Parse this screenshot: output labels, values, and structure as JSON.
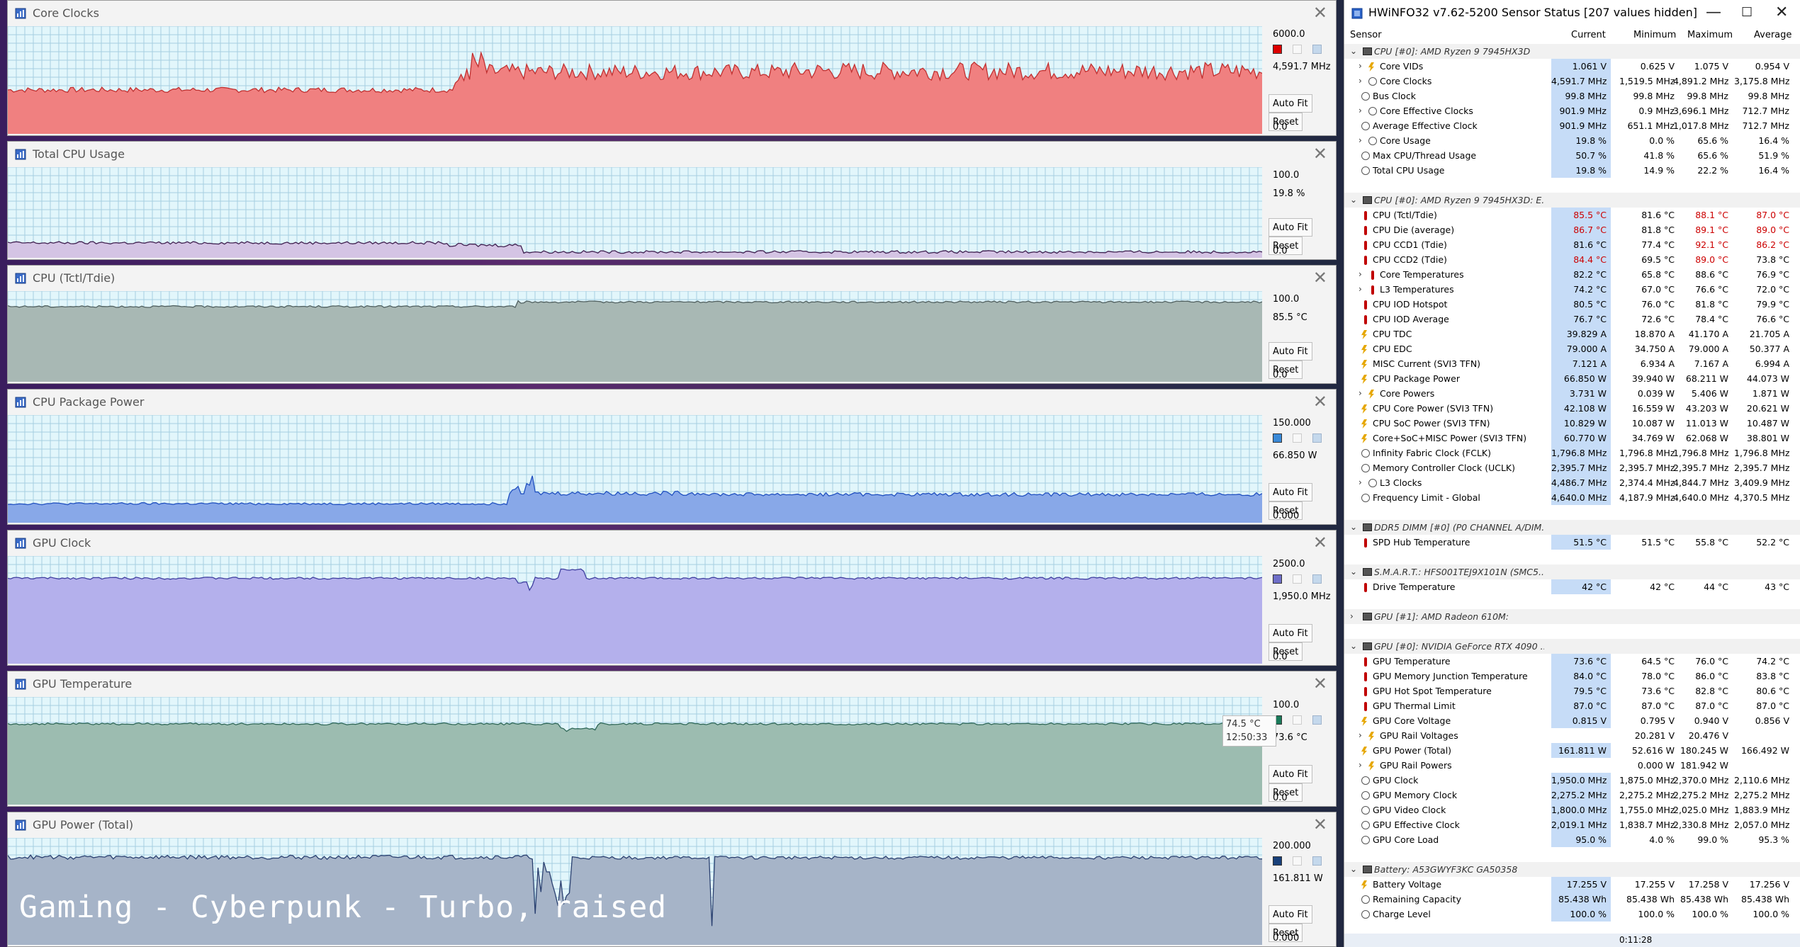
{
  "caption": "Gaming - Cyberpunk - Turbo, raised",
  "graph_buttons": {
    "autofit": "Auto Fit",
    "reset": "Reset"
  },
  "tooltip": {
    "value": "74.5 °C",
    "time": "12:50:33"
  },
  "graphs": [
    {
      "id": "core-clocks",
      "title": "Core Clocks",
      "max": "6000.0",
      "current": "4,591.7 MHz",
      "min": "0.0",
      "color": "#f08080",
      "line": "#c03030",
      "square": "#dd0000",
      "ymax": 6000,
      "segments": [
        [
          0,
          0.355,
          2300,
          2600
        ],
        [
          0.355,
          0.365,
          2500,
          3400
        ],
        [
          0.365,
          0.38,
          2800,
          4700
        ],
        [
          0.38,
          0.62,
          3000,
          3900
        ],
        [
          0.62,
          1.0,
          3000,
          4000
        ]
      ]
    },
    {
      "id": "total-cpu-usage",
      "title": "Total CPU Usage",
      "max": "100.0",
      "current": "19.8 %",
      "min": "0.0",
      "color": "#d4c4e4",
      "line": "#402050",
      "square": "",
      "ymax": 100,
      "segments": [
        [
          0,
          0.35,
          15,
          18
        ],
        [
          0.35,
          0.41,
          12,
          16
        ],
        [
          0.41,
          1.0,
          5,
          8
        ]
      ]
    },
    {
      "id": "cpu-tctl",
      "title": "CPU (Tctl/Tdie)",
      "max": "100.0",
      "current": "85.5 °C",
      "min": "0.0",
      "color": "#a8b8b4",
      "line": "#506060",
      "square": "",
      "ymax": 100,
      "segments": [
        [
          0,
          0.405,
          82,
          84
        ],
        [
          0.405,
          0.41,
          86,
          90
        ],
        [
          0.41,
          1.0,
          87,
          89
        ]
      ]
    },
    {
      "id": "cpu-package-power",
      "title": "CPU Package Power",
      "max": "150.000",
      "current": "66.850 W",
      "min": "0.000",
      "color": "#88a8e8",
      "line": "#2050c0",
      "square": "#3a8ad8",
      "ymax": 150,
      "segments": [
        [
          0,
          0.4,
          25,
          28
        ],
        [
          0.4,
          0.42,
          40,
          70
        ],
        [
          0.42,
          0.56,
          38,
          44
        ],
        [
          0.56,
          1.0,
          37,
          42
        ]
      ]
    },
    {
      "id": "gpu-clock",
      "title": "GPU Clock",
      "max": "2500.0",
      "current": "1,950.0 MHz",
      "min": "0.0",
      "color": "#b4b0ec",
      "line": "#4040a0",
      "square": "#6f6fc8",
      "ymax": 2500,
      "segments": [
        [
          0,
          0.405,
          1960,
          2010
        ],
        [
          0.405,
          0.42,
          1700,
          1900
        ],
        [
          0.44,
          0.46,
          2150,
          2200
        ],
        [
          0.46,
          1.0,
          1960,
          2010
        ]
      ]
    },
    {
      "id": "gpu-temperature",
      "title": "GPU Temperature",
      "max": "100.0",
      "current": "73.6 °C",
      "min": "0.0",
      "color": "#9cbcb0",
      "line": "#306858",
      "square": "#1a7a5a",
      "ymax": 100,
      "segments": [
        [
          0,
          0.44,
          74,
          76
        ],
        [
          0.44,
          0.47,
          68,
          72
        ],
        [
          0.47,
          1.0,
          74,
          76
        ]
      ]
    },
    {
      "id": "gpu-power-total",
      "title": "GPU Power (Total)",
      "max": "200.000",
      "current": "161.811 W",
      "min": "0.000",
      "color": "#a6b4c8",
      "line": "#2a4070",
      "square": "#18407a",
      "ymax": 200,
      "segments": [
        [
          0,
          0.42,
          160,
          168
        ],
        [
          0.42,
          0.45,
          30,
          160
        ],
        [
          0.45,
          0.56,
          160,
          166
        ],
        [
          0.56,
          0.562,
          20,
          160
        ],
        [
          0.562,
          1.0,
          160,
          166
        ]
      ]
    }
  ],
  "hw": {
    "title": "HWiNFO32 v7.62-5200 Sensor Status [207 values hidden]",
    "columns": {
      "sensor": "Sensor",
      "current": "Current",
      "minimum": "Minimum",
      "maximum": "Maximum",
      "average": "Average"
    },
    "status_time": "0:11:28",
    "rows": [
      {
        "g": 1,
        "icon": "chip",
        "name": "CPU [#0]: AMD Ryzen 9 7945HX3D"
      },
      {
        "icon": "bolt",
        "exp": 1,
        "name": "Core VIDs",
        "c": "1.061 V",
        "mi": "0.625 V",
        "ma": "1.075 V",
        "a": "0.954 V"
      },
      {
        "icon": "clock",
        "exp": 1,
        "name": "Core Clocks",
        "c": "4,591.7 MHz",
        "mi": "1,519.5 MHz",
        "ma": "4,891.2 MHz",
        "a": "3,175.8 MHz"
      },
      {
        "icon": "clock",
        "name": "Bus Clock",
        "c": "99.8 MHz",
        "mi": "99.8 MHz",
        "ma": "99.8 MHz",
        "a": "99.8 MHz"
      },
      {
        "icon": "clock",
        "exp": 1,
        "name": "Core Effective Clocks",
        "c": "901.9 MHz",
        "mi": "0.9 MHz",
        "ma": "3,696.1 MHz",
        "a": "712.7 MHz"
      },
      {
        "icon": "clock",
        "name": "Average Effective Clock",
        "c": "901.9 MHz",
        "mi": "651.1 MHz",
        "ma": "1,017.8 MHz",
        "a": "712.7 MHz"
      },
      {
        "icon": "clock",
        "exp": 1,
        "name": "Core Usage",
        "c": "19.8 %",
        "mi": "0.0 %",
        "ma": "65.6 %",
        "a": "16.4 %"
      },
      {
        "icon": "clock",
        "name": "Max CPU/Thread Usage",
        "c": "50.7 %",
        "mi": "41.8 %",
        "ma": "65.6 %",
        "a": "51.9 %"
      },
      {
        "icon": "clock",
        "name": "Total CPU Usage",
        "c": "19.8 %",
        "mi": "14.9 %",
        "ma": "22.2 %",
        "a": "16.4 %"
      },
      {
        "blank": 1
      },
      {
        "g": 1,
        "icon": "chip",
        "name": "CPU [#0]: AMD Ryzen 9 7945HX3D: E..."
      },
      {
        "icon": "therm",
        "name": "CPU (Tctl/Tdie)",
        "c": "85.5 °C",
        "mi": "81.6 °C",
        "ma": "88.1 °C",
        "a": "87.0 °C",
        "red": [
          "c",
          "ma",
          "a"
        ]
      },
      {
        "icon": "therm",
        "name": "CPU Die (average)",
        "c": "86.7 °C",
        "mi": "81.8 °C",
        "ma": "89.1 °C",
        "a": "89.0 °C",
        "red": [
          "c",
          "ma",
          "a"
        ]
      },
      {
        "icon": "therm",
        "name": "CPU CCD1 (Tdie)",
        "c": "81.6 °C",
        "mi": "77.4 °C",
        "ma": "92.1 °C",
        "a": "86.2 °C",
        "red": [
          "ma",
          "a"
        ]
      },
      {
        "icon": "therm",
        "name": "CPU CCD2 (Tdie)",
        "c": "84.4 °C",
        "mi": "69.5 °C",
        "ma": "89.0 °C",
        "a": "73.8 °C",
        "red": [
          "c",
          "ma"
        ]
      },
      {
        "icon": "therm",
        "exp": 1,
        "name": "Core Temperatures",
        "c": "82.2 °C",
        "mi": "65.8 °C",
        "ma": "88.6 °C",
        "a": "76.9 °C"
      },
      {
        "icon": "therm",
        "exp": 1,
        "name": "L3 Temperatures",
        "c": "74.2 °C",
        "mi": "67.0 °C",
        "ma": "76.6 °C",
        "a": "72.0 °C"
      },
      {
        "icon": "therm",
        "name": "CPU IOD Hotspot",
        "c": "80.5 °C",
        "mi": "76.0 °C",
        "ma": "81.8 °C",
        "a": "79.9 °C"
      },
      {
        "icon": "therm",
        "name": "CPU IOD Average",
        "c": "76.7 °C",
        "mi": "72.6 °C",
        "ma": "78.4 °C",
        "a": "76.6 °C"
      },
      {
        "icon": "bolt",
        "name": "CPU TDC",
        "c": "39.829 A",
        "mi": "18.870 A",
        "ma": "41.170 A",
        "a": "21.705 A"
      },
      {
        "icon": "bolt",
        "name": "CPU EDC",
        "c": "79.000 A",
        "mi": "34.750 A",
        "ma": "79.000 A",
        "a": "50.377 A"
      },
      {
        "icon": "bolt",
        "name": "MISC Current (SVI3 TFN)",
        "c": "7.121 A",
        "mi": "6.934 A",
        "ma": "7.167 A",
        "a": "6.994 A"
      },
      {
        "icon": "bolt",
        "name": "CPU Package Power",
        "c": "66.850 W",
        "mi": "39.940 W",
        "ma": "68.211 W",
        "a": "44.073 W"
      },
      {
        "icon": "bolt",
        "exp": 1,
        "name": "Core Powers",
        "c": "3.731 W",
        "mi": "0.039 W",
        "ma": "5.406 W",
        "a": "1.871 W"
      },
      {
        "icon": "bolt",
        "name": "CPU Core Power (SVI3 TFN)",
        "c": "42.108 W",
        "mi": "16.559 W",
        "ma": "43.203 W",
        "a": "20.621 W"
      },
      {
        "icon": "bolt",
        "name": "CPU SoC Power (SVI3 TFN)",
        "c": "10.829 W",
        "mi": "10.087 W",
        "ma": "11.013 W",
        "a": "10.487 W"
      },
      {
        "icon": "bolt",
        "name": "Core+SoC+MISC Power (SVI3 TFN)",
        "c": "60.770 W",
        "mi": "34.769 W",
        "ma": "62.068 W",
        "a": "38.801 W"
      },
      {
        "icon": "clock",
        "name": "Infinity Fabric Clock (FCLK)",
        "c": "1,796.8 MHz",
        "mi": "1,796.8 MHz",
        "ma": "1,796.8 MHz",
        "a": "1,796.8 MHz"
      },
      {
        "icon": "clock",
        "name": "Memory Controller Clock (UCLK)",
        "c": "2,395.7 MHz",
        "mi": "2,395.7 MHz",
        "ma": "2,395.7 MHz",
        "a": "2,395.7 MHz"
      },
      {
        "icon": "clock",
        "exp": 1,
        "name": "L3 Clocks",
        "c": "4,486.7 MHz",
        "mi": "2,374.4 MHz",
        "ma": "4,844.7 MHz",
        "a": "3,409.9 MHz"
      },
      {
        "icon": "clock",
        "name": "Frequency Limit - Global",
        "c": "4,640.0 MHz",
        "mi": "4,187.9 MHz",
        "ma": "4,640.0 MHz",
        "a": "4,370.5 MHz"
      },
      {
        "blank": 1
      },
      {
        "g": 1,
        "icon": "chip",
        "name": "DDR5 DIMM [#0] (P0 CHANNEL A/DIM..."
      },
      {
        "icon": "therm",
        "name": "SPD Hub Temperature",
        "c": "51.5 °C",
        "mi": "51.5 °C",
        "ma": "55.8 °C",
        "a": "52.2 °C"
      },
      {
        "blank": 1
      },
      {
        "g": 1,
        "icon": "chip",
        "name": "S.M.A.R.T.: HFS001TEJ9X101N (SMC5..."
      },
      {
        "icon": "therm",
        "name": "Drive Temperature",
        "c": "42 °C",
        "mi": "42 °C",
        "ma": "44 °C",
        "a": "43 °C"
      },
      {
        "blank": 1
      },
      {
        "g": 1,
        "gexp": 1,
        "icon": "chip",
        "name": "GPU [#1]: AMD Radeon 610M:"
      },
      {
        "blank": 1
      },
      {
        "g": 1,
        "icon": "chip",
        "name": "GPU [#0]: NVIDIA GeForce RTX 4090 ..."
      },
      {
        "icon": "therm",
        "name": "GPU Temperature",
        "c": "73.6 °C",
        "mi": "64.5 °C",
        "ma": "76.0 °C",
        "a": "74.2 °C"
      },
      {
        "icon": "therm",
        "name": "GPU Memory Junction Temperature",
        "c": "84.0 °C",
        "mi": "78.0 °C",
        "ma": "86.0 °C",
        "a": "83.8 °C"
      },
      {
        "icon": "therm",
        "name": "GPU Hot Spot Temperature",
        "c": "79.5 °C",
        "mi": "73.6 °C",
        "ma": "82.8 °C",
        "a": "80.6 °C"
      },
      {
        "icon": "therm",
        "name": "GPU Thermal Limit",
        "c": "87.0 °C",
        "mi": "87.0 °C",
        "ma": "87.0 °C",
        "a": "87.0 °C"
      },
      {
        "icon": "bolt",
        "name": "GPU Core Voltage",
        "c": "0.815 V",
        "mi": "0.795 V",
        "ma": "0.940 V",
        "a": "0.856 V"
      },
      {
        "icon": "bolt",
        "exp": 1,
        "name": "GPU Rail Voltages",
        "c": "",
        "mi": "20.281 V",
        "ma": "20.476 V",
        "a": ""
      },
      {
        "icon": "bolt",
        "name": "GPU Power (Total)",
        "c": "161.811 W",
        "mi": "52.616 W",
        "ma": "180.245 W",
        "a": "166.492 W"
      },
      {
        "icon": "bolt",
        "exp": 1,
        "name": "GPU Rail Powers",
        "c": "",
        "mi": "0.000 W",
        "ma": "181.942 W",
        "a": ""
      },
      {
        "icon": "clock",
        "name": "GPU Clock",
        "c": "1,950.0 MHz",
        "mi": "1,875.0 MHz",
        "ma": "2,370.0 MHz",
        "a": "2,110.6 MHz"
      },
      {
        "icon": "clock",
        "name": "GPU Memory Clock",
        "c": "2,275.2 MHz",
        "mi": "2,275.2 MHz",
        "ma": "2,275.2 MHz",
        "a": "2,275.2 MHz"
      },
      {
        "icon": "clock",
        "name": "GPU Video Clock",
        "c": "1,800.0 MHz",
        "mi": "1,755.0 MHz",
        "ma": "2,025.0 MHz",
        "a": "1,883.9 MHz"
      },
      {
        "icon": "clock",
        "name": "GPU Effective Clock",
        "c": "2,019.1 MHz",
        "mi": "1,838.7 MHz",
        "ma": "2,330.8 MHz",
        "a": "2,057.0 MHz"
      },
      {
        "icon": "clock",
        "name": "GPU Core Load",
        "c": "95.0 %",
        "mi": "4.0 %",
        "ma": "99.0 %",
        "a": "95.3 %"
      },
      {
        "blank": 1
      },
      {
        "g": 1,
        "icon": "chip",
        "name": "Battery: A53GWYF3KC GA50358"
      },
      {
        "icon": "bolt",
        "name": "Battery Voltage",
        "c": "17.255 V",
        "mi": "17.255 V",
        "ma": "17.258 V",
        "a": "17.256 V"
      },
      {
        "icon": "clock",
        "name": "Remaining Capacity",
        "c": "85.438 Wh",
        "mi": "85.438 Wh",
        "ma": "85.438 Wh",
        "a": "85.438 Wh"
      },
      {
        "icon": "clock",
        "name": "Charge Level",
        "c": "100.0 %",
        "mi": "100.0 %",
        "ma": "100.0 %",
        "a": "100.0 %"
      }
    ]
  }
}
